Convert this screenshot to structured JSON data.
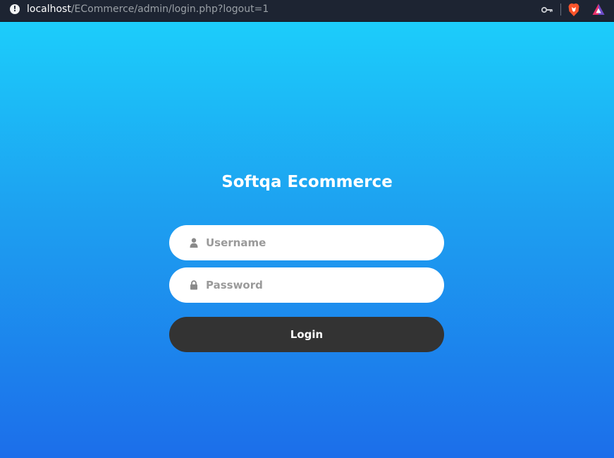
{
  "browser": {
    "url_host": "localhost",
    "url_path": "/ECommerce/admin/login.php?logout=1",
    "info_icon": "!",
    "icons": [
      "info-icon",
      "key-icon",
      "brave-shield-icon",
      "brave-rewards-icon"
    ]
  },
  "login": {
    "title": "Softqa Ecommerce",
    "username_placeholder": "Username",
    "password_placeholder": "Password",
    "login_label": "Login",
    "icons": [
      "user-icon",
      "lock-icon"
    ]
  },
  "colors": {
    "gradient_top": "#1ccdfb",
    "gradient_bottom": "#1c6eea",
    "button": "#333333",
    "title": "#ffffff",
    "toolbar": "#1d2432"
  }
}
